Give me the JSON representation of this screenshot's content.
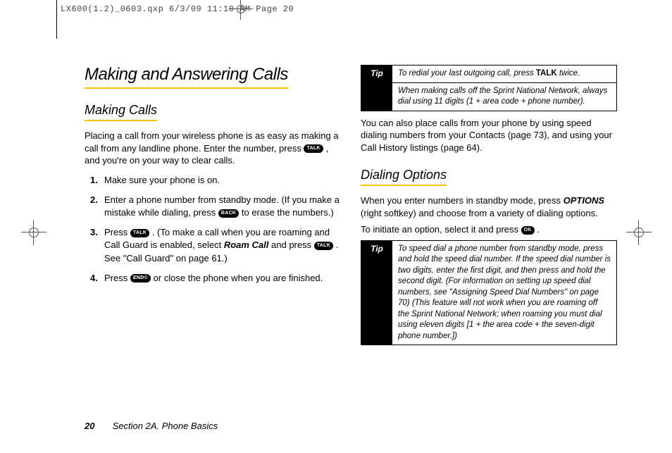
{
  "preprint": "LX600(1.2)_0603.qxp  6/3/09  11:10 AM  Page 20",
  "chapter_title": "Making and Answering Calls",
  "left": {
    "section_title": "Making Calls",
    "intro_before_badge": "Placing a call from your wireless phone is as easy as making a call from any landline phone. Enter the number, press ",
    "intro_after_badge": ", and you're on your way to clear calls.",
    "steps": {
      "s1": "Make sure your phone is on.",
      "s2_before": "Enter a phone number from standby mode. (If you make a mistake while dialing, press ",
      "s2_after": " to erase the numbers.)",
      "s3_before": "Press ",
      "s3_mid1": ". (To make a call when you are roaming and Call Guard is enabled, select ",
      "s3_roam": "Roam Call",
      "s3_mid2": " and press ",
      "s3_after": ". See \"Call Guard\" on page 61.)",
      "s4_before": "Press ",
      "s4_after": " or close the phone when you are finished."
    }
  },
  "badges": {
    "talk": "TALK",
    "back": "BACK",
    "end": "END©",
    "ok": "OK"
  },
  "right": {
    "tip1_label": "Tip",
    "tip1_row1_a": "To redial your last outgoing call, press ",
    "tip1_row1_b": "TALK",
    "tip1_row1_c": " twice.",
    "tip1_row2": "When making calls off the Sprint National Network, always dial using 11 digits (1 + area code + phone number).",
    "para1": "You can also place calls from your phone by using speed dialing numbers from your Contacts (page 73), and using your Call History listings (page 64).",
    "section_title": "Dialing Options",
    "para2_a": "When you enter numbers in standby mode, press ",
    "para2_opt": "OPTIONS",
    "para2_b": " (right softkey) and choose from  a variety of dialing options.",
    "para3_a": "To initiate an option, select it and press ",
    "para3_b": ".",
    "tip2_label": "Tip",
    "tip2_row1": "To speed dial a phone number from standby mode, press and hold the speed dial number. If the speed dial number is two digits, enter the first digit, and then press and hold the second digit. (For information on setting up speed dial numbers, see \"Assigning Speed Dial Numbers\" on page 70) (This feature will not work when you are roaming off the Sprint National Network; when roaming you must dial using eleven digits [1 + the area code + the seven-digit phone number.])"
  },
  "footer": {
    "page_number": "20",
    "section_label": "Section 2A. Phone Basics"
  }
}
